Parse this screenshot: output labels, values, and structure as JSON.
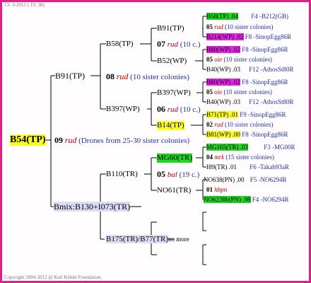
{
  "header": {
    "date_line": "13-  3-2012 ( 19: 38)"
  },
  "footer": {
    "copyright": "Copyright 2004-2012 @ Karl Kehde Foundation."
  },
  "root": {
    "label": "B54(TP)"
  },
  "gen1": {
    "num": "09",
    "word": "rud",
    "note": "(Drones from 25-30 sister colonies)",
    "father": "B91(TP)",
    "mother": "Bmix:B130+I073(TR)"
  },
  "gen2": [
    {
      "num": "08",
      "word": "rud",
      "note": "(10 sister colonies)",
      "upper": "B58(TP)",
      "lower": "B397(WP)"
    },
    {
      "num": "05",
      "word": "bal",
      "note": "(19 c.)",
      "upper": "B110(TR)",
      "lower": "B175(TR)/B77(TR)",
      "lower_note": "no more"
    }
  ],
  "gen3": [
    {
      "num": "07",
      "word": "rud",
      "note": "(10 c.)",
      "upper": "B91(TP)",
      "lower": "B52(WP)"
    },
    {
      "num": "06",
      "word": "rud",
      "note": "(10 c.)",
      "upper": "B397(WP)",
      "lower": "B14(TP)"
    },
    {
      "upper": "MG60(TR)",
      "lower": "NO61(TR)"
    }
  ],
  "gen4": [
    {
      "top": "B58(TP) .04",
      "top_note": "F4 -B212(GB)",
      "num": "05",
      "word": "rud",
      "mid_note": "(10 sister colonies)",
      "bottom": "B214(WP) .02",
      "bottom_note": "F8 -SinopEgg86R"
    },
    {
      "top": "B80(WP) .02",
      "top_note": "F8 -SinopEgg86R",
      "num": "05",
      "word": "oie",
      "mid_note": "(10 sister colonies)",
      "bottom": "B40(WP) .03",
      "bottom_note": "F12 -AthosSt80R"
    },
    {
      "top": "B80(WP) .02",
      "top_note": "F8 -SinopEgg86R",
      "num": "05",
      "word": "oie",
      "mid_note": "(10 sister colonies)",
      "bottom": "B40(WP) .03",
      "bottom_note": "F12 -AthosSt80R"
    },
    {
      "top": "B71(TP) .01",
      "top_note": "F9 -SinopEgg86R",
      "num": "02",
      "word": "rud",
      "mid_note": "(10 sister colonies)",
      "bottom": "B81(WP) .00",
      "bottom_note": "F8 -SinopEgg86R"
    },
    {
      "top": "MG165(TR) .03",
      "top_note": "F3 -MG00R",
      "num": "04",
      "word": "mrk",
      "mid_note": "(15 sister colonies)",
      "bottom": "I89(TR) .01",
      "bottom_note": "F6 -Takab93aR"
    },
    {
      "top": "NO638(PN) .00",
      "top_note": "F5 -NO6294R",
      "num": "01",
      "word": "hbpn",
      "mid_note": "",
      "bottom": "NO6238b(PN) .98",
      "bottom_note": "F4 -NO6294R"
    }
  ]
}
